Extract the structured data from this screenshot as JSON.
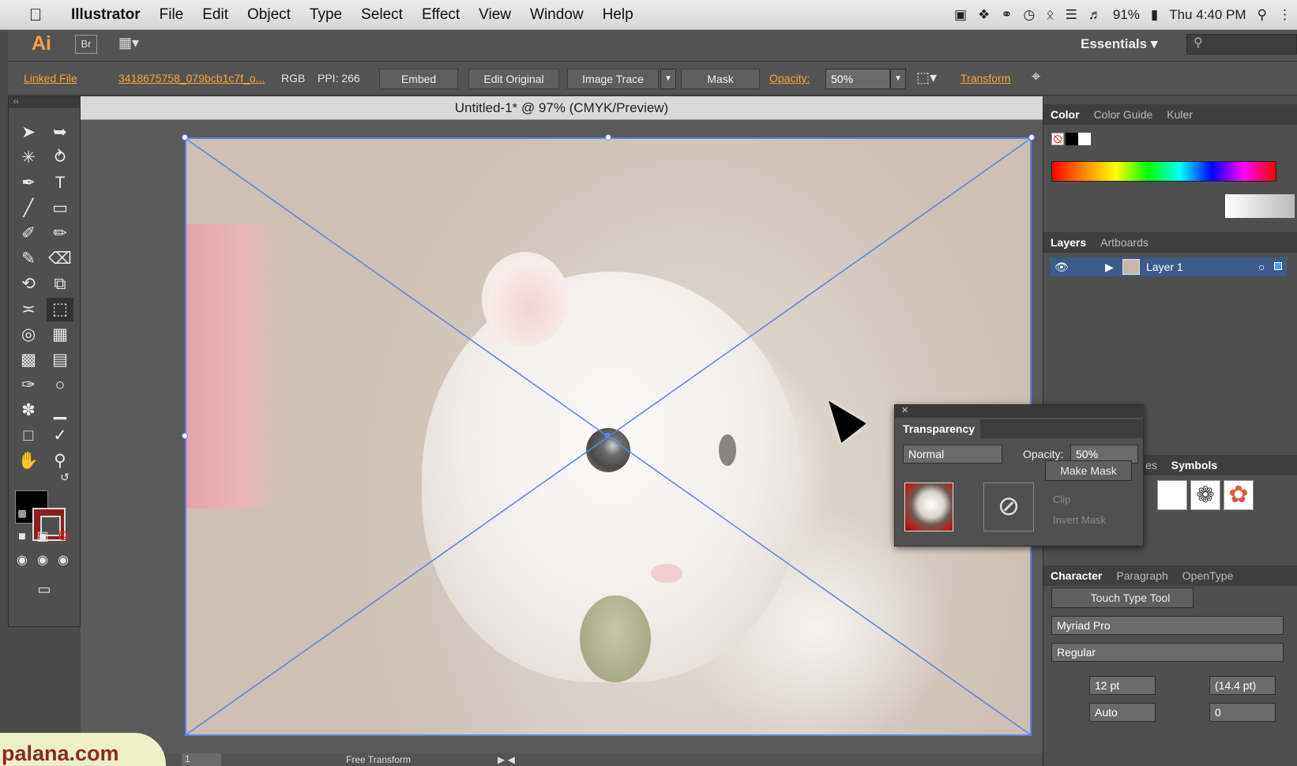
{
  "menubar": {
    "apple_icon": "apple-logo-icon",
    "items": [
      "Illustrator",
      "File",
      "Edit",
      "Object",
      "Type",
      "Select",
      "Effect",
      "View",
      "Window",
      "Help"
    ],
    "battery": "91%",
    "clock": "Thu 4:40 PM"
  },
  "appbar": {
    "logo": "Ai",
    "bridge": "Br",
    "workspace": "Essentials"
  },
  "control": {
    "linked_file": "Linked File",
    "filename": "3418675758_079bcb1c7f_o...",
    "color_mode": "RGB",
    "ppi": "PPI: 266",
    "embed": "Embed",
    "edit_original": "Edit Original",
    "image_trace": "Image Trace",
    "mask": "Mask",
    "opacity_label": "Opacity:",
    "opacity_value": "50%",
    "transform": "Transform"
  },
  "document": {
    "title": "Untitled-1* @ 97% (CMYK/Preview)",
    "status_zoom": "1",
    "status_tool": "Free Transform"
  },
  "watermark": "palana.com",
  "color_panel": {
    "tabs": [
      "Color",
      "Color Guide",
      "Kuler"
    ]
  },
  "layers_panel": {
    "tabs": [
      "Layers",
      "Artboards"
    ],
    "layer_name": "Layer 1"
  },
  "transparency_panel": {
    "title": "Transparency",
    "blend_mode": "Normal",
    "opacity_label": "Opacity:",
    "opacity_value": "50%",
    "make_mask": "Make Mask",
    "clip": "Clip",
    "invert_mask": "Invert Mask"
  },
  "symbols_panel": {
    "tabs_partial": "es",
    "tab": "Symbols"
  },
  "character_panel": {
    "tabs": [
      "Character",
      "Paragraph",
      "OpenType"
    ],
    "touch_type": "Touch Type Tool",
    "font_family": "Myriad Pro",
    "font_style": "Regular",
    "font_size": "12 pt",
    "leading": "(14.4 pt)",
    "kerning": "Auto",
    "tracking": "0"
  },
  "colors": {
    "accent_orange": "#f7a13d",
    "selection_blue": "#5b84e8",
    "layer_highlight": "#3d5a8a"
  }
}
